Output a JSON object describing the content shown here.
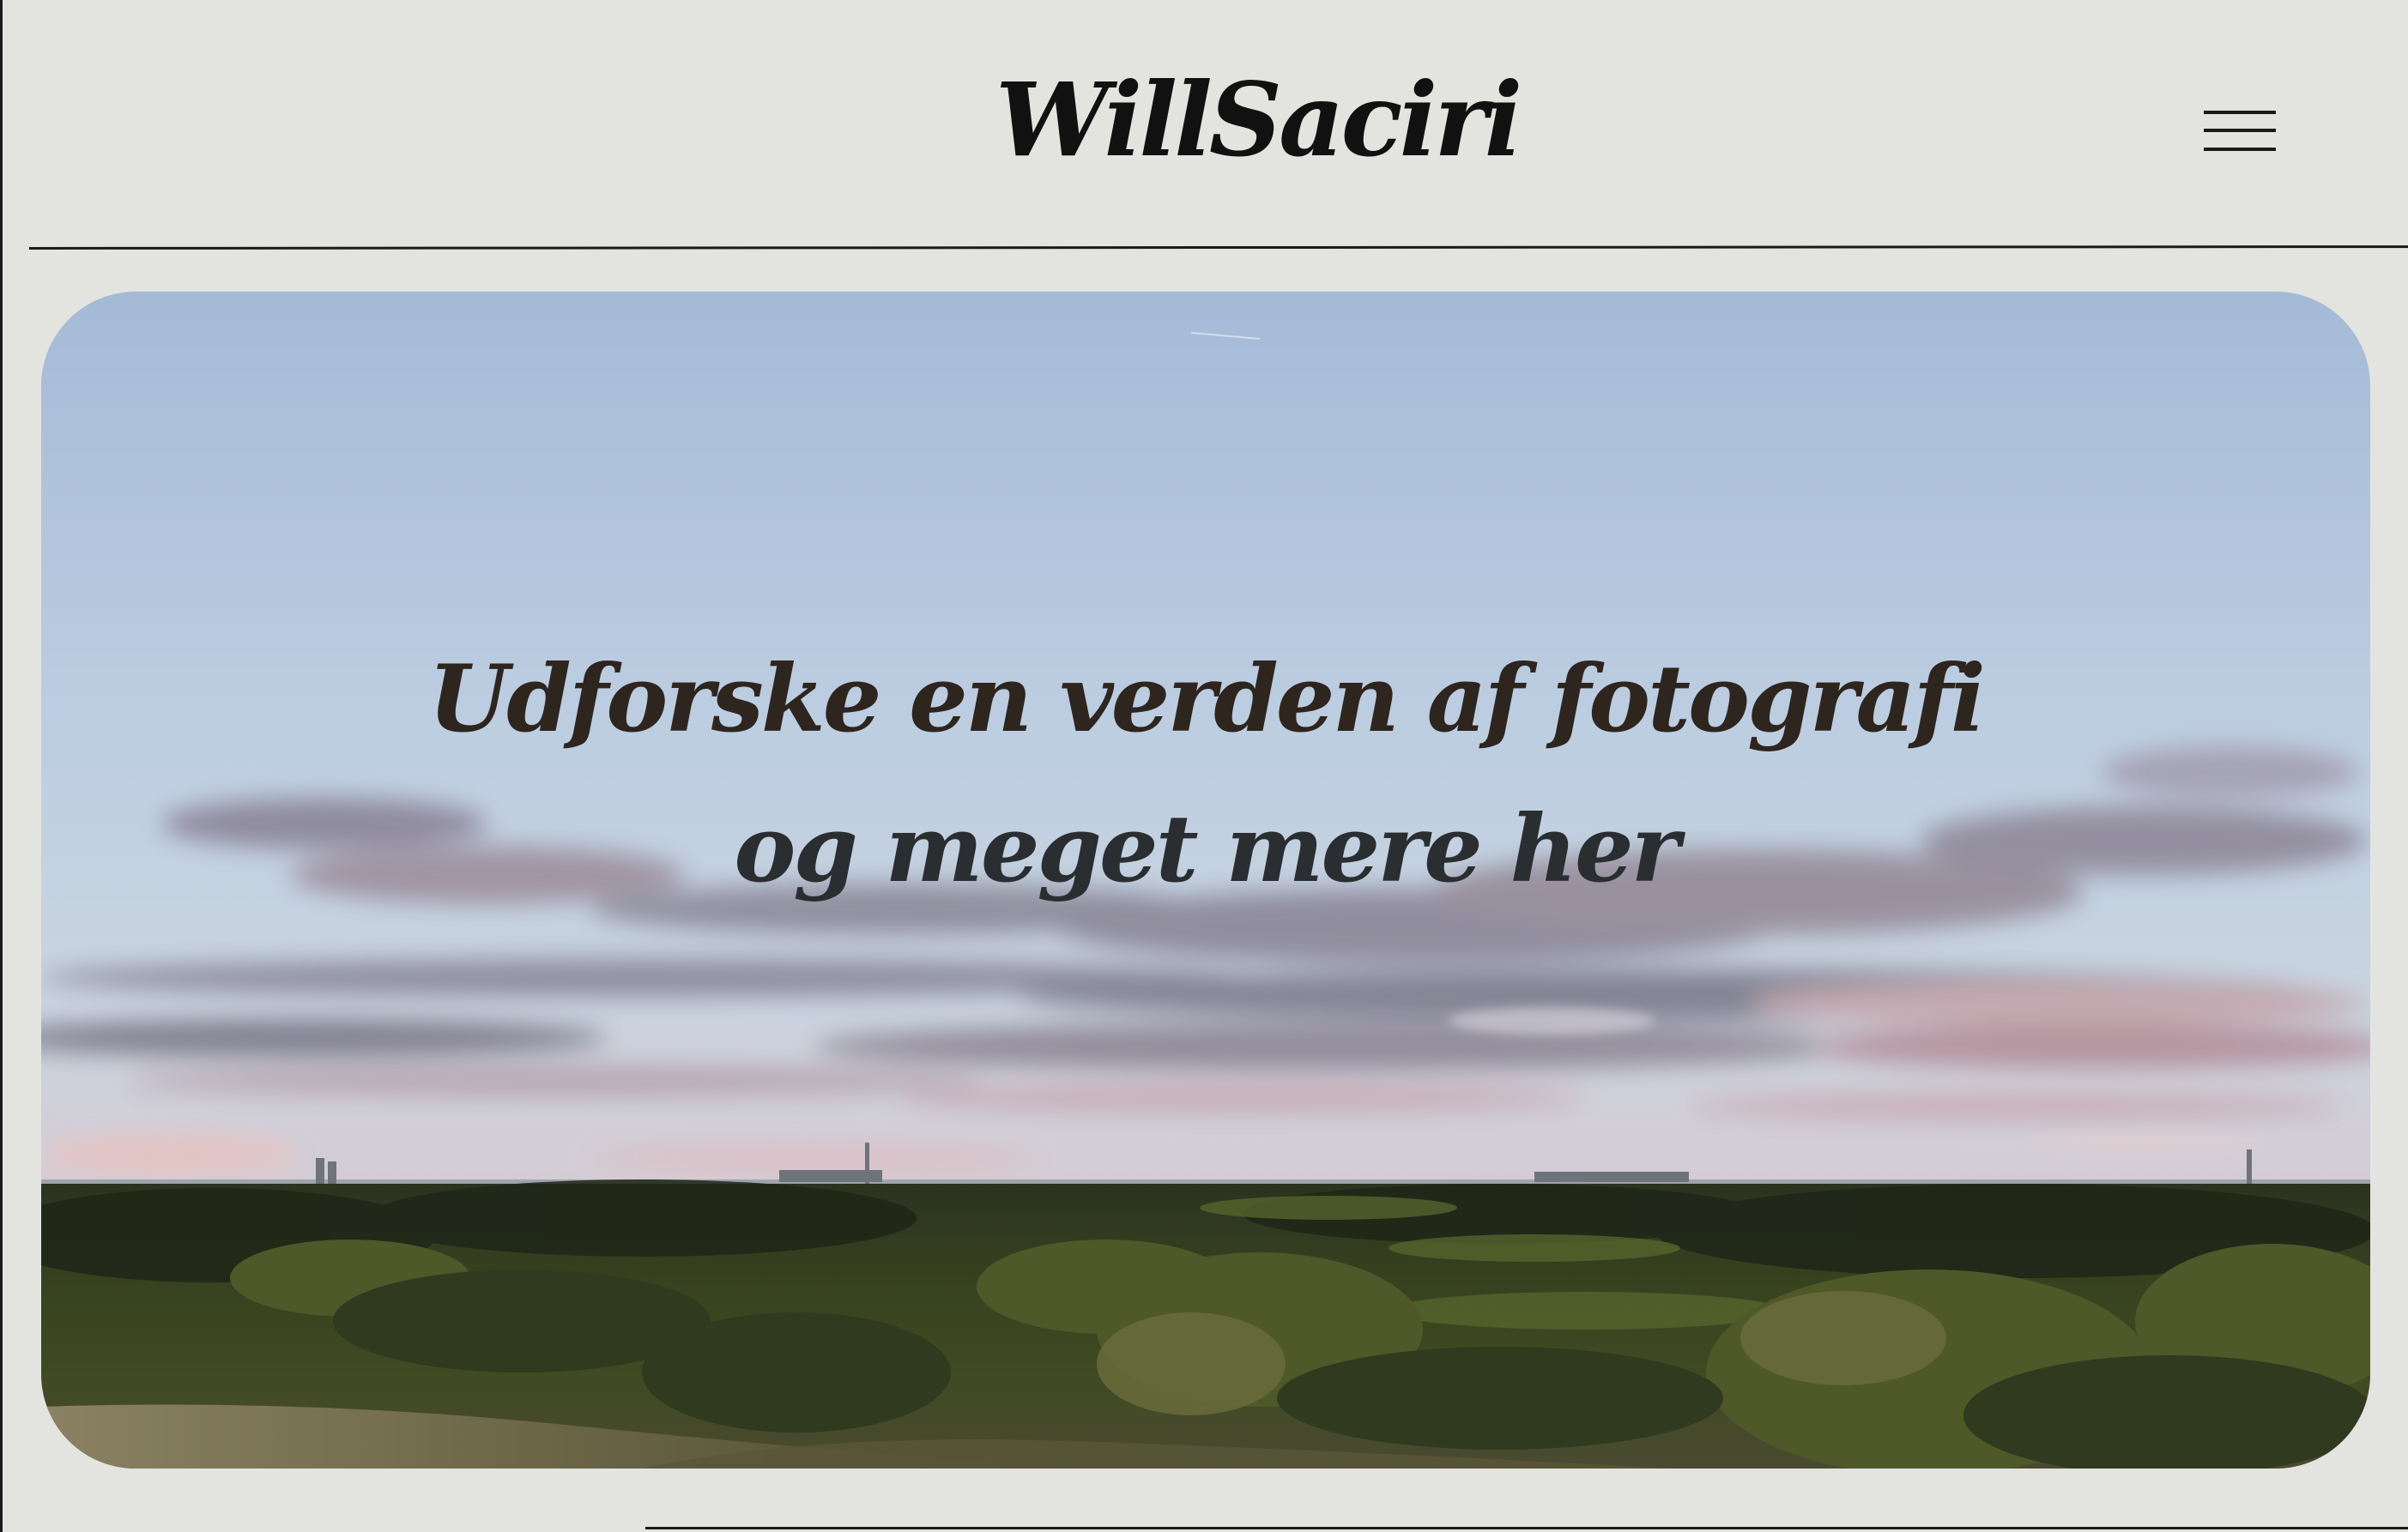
{
  "header": {
    "logo_text": "WillSaciri",
    "menu_icon": "hamburger-menu-icon"
  },
  "hero": {
    "image_subject": "landscape-photo-sky-clouds-forest",
    "heading_line1": "Udforske en verden af fotografi",
    "heading_line2": "og meget mere her"
  },
  "colors": {
    "background": "#e3e4e0",
    "text_dark": "#111111",
    "heading_line1": "#2f251f",
    "heading_line2": "#2a2e31"
  }
}
